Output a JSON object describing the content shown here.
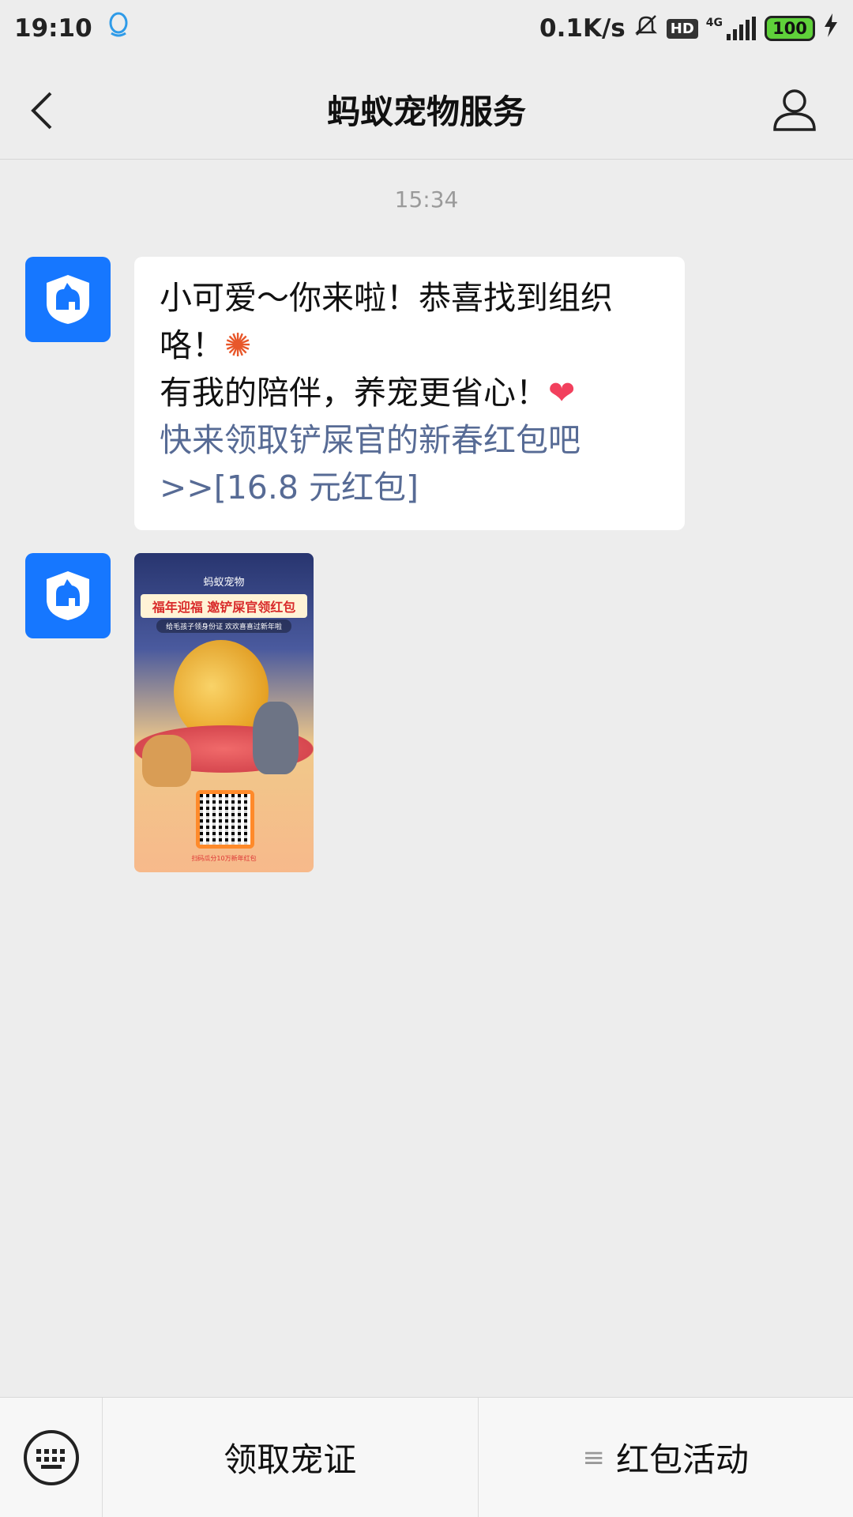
{
  "status_bar": {
    "time": "19:10",
    "network_speed": "0.1K/s",
    "hd_label": "HD",
    "signal_label": "4G",
    "battery": "100",
    "icons": [
      "qq-icon",
      "bell-muted-icon",
      "signal-icon",
      "charging-icon"
    ]
  },
  "header": {
    "title": "蚂蚁宠物服务"
  },
  "chat": {
    "timestamp": "15:34",
    "message1": {
      "line1": "小可爱～你来啦！恭喜找到组织",
      "line2": "咯！",
      "line3": " 有我的陪伴，养宠更省心！",
      "link_line1": "快来领取铲屎官的新春红包吧",
      "link_line2": ">>[16.8 元红包]"
    },
    "image_card": {
      "brand": "蚂蚁宠物",
      "headline": "福年迎福 邀铲屎官领红包",
      "subline": "给毛孩子领身份证 欢欢喜喜过新年啦",
      "footer": "扫码瓜分10万新年红包"
    }
  },
  "bottom_menu": {
    "item1": "领取宠证",
    "item2": "红包活动"
  },
  "colors": {
    "background": "#ededed",
    "accent": "#1677ff",
    "link": "#576b95"
  }
}
